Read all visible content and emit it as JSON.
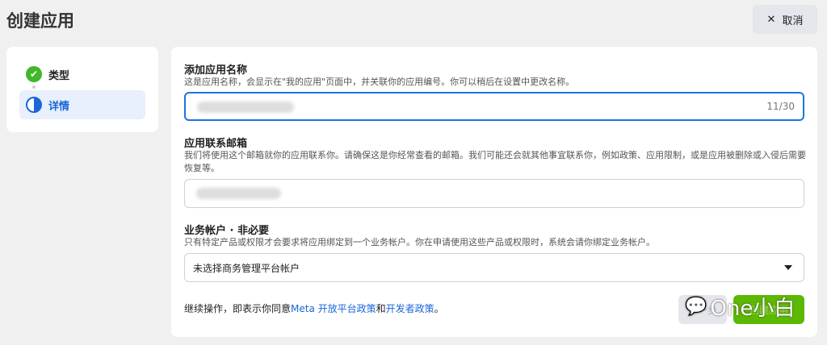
{
  "header": {
    "title": "创建应用",
    "cancel_label": "取消"
  },
  "steps": [
    {
      "label": "类型",
      "status": "done"
    },
    {
      "label": "详情",
      "status": "current"
    }
  ],
  "form": {
    "name": {
      "label": "添加应用名称",
      "description": "这是应用名称，会显示在\"我的应用\"页面中，并关联你的应用编号。你可以稍后在设置中更改名称。",
      "counter": "11/30"
    },
    "email": {
      "label": "应用联系邮箱",
      "description": "我们将使用这个邮箱就你的应用联系你。请确保这是你经常查看的邮箱。我们可能还会就其他事宜联系你，例如政策、应用限制，或是应用被删除或入侵后需要恢复等。"
    },
    "business": {
      "label": "业务帐户 · 非必要",
      "description": "只有特定产品或权限才会要求将应用绑定到一个业务帐户。你在申请使用这些产品或权限时，系统会请你绑定业务帐户。",
      "selected": "未选择商务管理平台帐户"
    }
  },
  "terms": {
    "prefix": "继续操作，即表示你同意",
    "link1": "Meta 开放平台政策",
    "and": "和",
    "link2": "开发者政策",
    "suffix": "。"
  },
  "footer": {
    "back_label": "上一步",
    "next_label": "创建应用"
  },
  "watermark": "One小白",
  "colors": {
    "accent": "#1b74e4",
    "primary_button": "#5cb800",
    "done": "#42b72a"
  }
}
